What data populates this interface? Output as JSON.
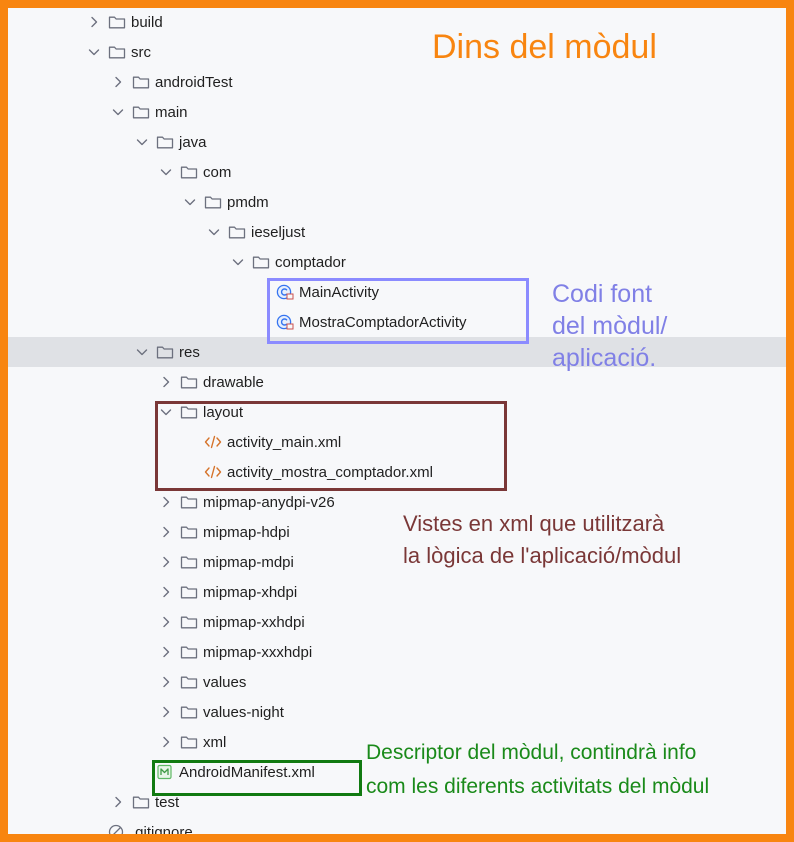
{
  "annotations": {
    "title": "Dins del mòdul",
    "source_note": [
      "Codi font",
      "del mòdul/",
      "aplicació."
    ],
    "views_note": [
      "Vistes en xml que utilitzarà",
      "la lògica de l'aplicació/mòdul"
    ],
    "manifest_note": [
      "Descriptor del mòdul, contindrà info",
      "com les diferents activitats del mòdul"
    ]
  },
  "tree": [
    {
      "label": "build",
      "type": "folder",
      "chevron": "right",
      "depth": 0
    },
    {
      "label": "src",
      "type": "folder",
      "chevron": "down",
      "depth": 0
    },
    {
      "label": "androidTest",
      "type": "folder",
      "chevron": "right",
      "depth": 1
    },
    {
      "label": "main",
      "type": "folder",
      "chevron": "down",
      "depth": 1
    },
    {
      "label": "java",
      "type": "folder",
      "chevron": "down",
      "depth": 2
    },
    {
      "label": "com",
      "type": "folder",
      "chevron": "down",
      "depth": 3
    },
    {
      "label": "pmdm",
      "type": "folder",
      "chevron": "down",
      "depth": 4
    },
    {
      "label": "ieseljust",
      "type": "folder",
      "chevron": "down",
      "depth": 5
    },
    {
      "label": "comptador",
      "type": "folder",
      "chevron": "down",
      "depth": 6
    },
    {
      "label": "MainActivity",
      "type": "class",
      "chevron": "none",
      "depth": 7
    },
    {
      "label": "MostraComptadorActivity",
      "type": "class",
      "chevron": "none",
      "depth": 7
    },
    {
      "label": "res",
      "type": "folder",
      "chevron": "down",
      "depth": 2,
      "selected": true
    },
    {
      "label": "drawable",
      "type": "folder",
      "chevron": "right",
      "depth": 3
    },
    {
      "label": "layout",
      "type": "folder",
      "chevron": "down",
      "depth": 3
    },
    {
      "label": "activity_main.xml",
      "type": "xml",
      "chevron": "none",
      "depth": 4
    },
    {
      "label": "activity_mostra_comptador.xml",
      "type": "xml",
      "chevron": "none",
      "depth": 4
    },
    {
      "label": "mipmap-anydpi-v26",
      "type": "folder",
      "chevron": "right",
      "depth": 3
    },
    {
      "label": "mipmap-hdpi",
      "type": "folder",
      "chevron": "right",
      "depth": 3
    },
    {
      "label": "mipmap-mdpi",
      "type": "folder",
      "chevron": "right",
      "depth": 3
    },
    {
      "label": "mipmap-xhdpi",
      "type": "folder",
      "chevron": "right",
      "depth": 3
    },
    {
      "label": "mipmap-xxhdpi",
      "type": "folder",
      "chevron": "right",
      "depth": 3
    },
    {
      "label": "mipmap-xxxhdpi",
      "type": "folder",
      "chevron": "right",
      "depth": 3
    },
    {
      "label": "values",
      "type": "folder",
      "chevron": "right",
      "depth": 3
    },
    {
      "label": "values-night",
      "type": "folder",
      "chevron": "right",
      "depth": 3
    },
    {
      "label": "xml",
      "type": "folder",
      "chevron": "right",
      "depth": 3
    },
    {
      "label": "AndroidManifest.xml",
      "type": "manifest",
      "chevron": "none",
      "depth": 2
    },
    {
      "label": "test",
      "type": "folder",
      "chevron": "right",
      "depth": 1
    },
    {
      "label": ".gitignore",
      "type": "ignored",
      "chevron": "none",
      "depth": 0
    }
  ],
  "colors": {
    "frame": "#f88510",
    "source_box": "#8b8bff",
    "layout_box": "#7a3737",
    "manifest_box": "#117a11",
    "selection": "#dfe1e5"
  }
}
